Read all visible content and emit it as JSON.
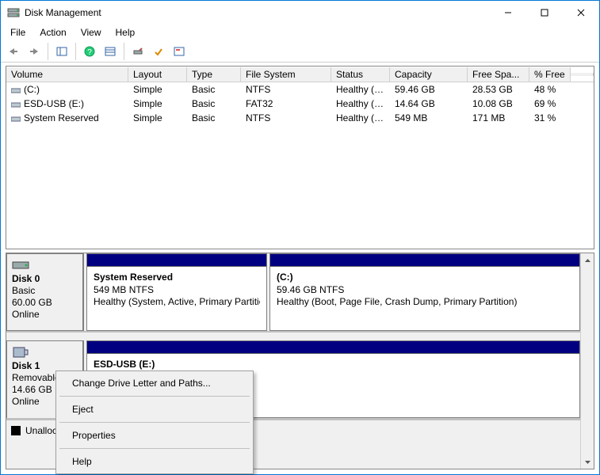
{
  "window": {
    "title": "Disk Management"
  },
  "menu": {
    "items": [
      "File",
      "Action",
      "View",
      "Help"
    ]
  },
  "volume_list": {
    "columns": [
      "Volume",
      "Layout",
      "Type",
      "File System",
      "Status",
      "Capacity",
      "Free Spa...",
      "% Free"
    ],
    "rows": [
      {
        "name": "(C:)",
        "layout": "Simple",
        "type": "Basic",
        "fs": "NTFS",
        "status": "Healthy (B...",
        "capacity": "59.46 GB",
        "free": "28.53 GB",
        "pct": "48 %"
      },
      {
        "name": "ESD-USB (E:)",
        "layout": "Simple",
        "type": "Basic",
        "fs": "FAT32",
        "status": "Healthy (A...",
        "capacity": "14.64 GB",
        "free": "10.08 GB",
        "pct": "69 %"
      },
      {
        "name": "System Reserved",
        "layout": "Simple",
        "type": "Basic",
        "fs": "NTFS",
        "status": "Healthy (S...",
        "capacity": "549 MB",
        "free": "171 MB",
        "pct": "31 %"
      }
    ]
  },
  "disks": {
    "disk0": {
      "label": "Disk 0",
      "kind": "Basic",
      "size": "60.00 GB",
      "state": "Online",
      "parts": [
        {
          "title": "System Reserved",
          "line2": "549 MB NTFS",
          "line3": "Healthy (System, Active, Primary Partition)"
        },
        {
          "title": "(C:)",
          "line2": "59.46 GB NTFS",
          "line3": "Healthy (Boot, Page File, Crash Dump, Primary Partition)"
        }
      ]
    },
    "disk1": {
      "label": "Disk 1",
      "kind": "Removable",
      "size": "14.66 GB",
      "state": "Online",
      "parts": [
        {
          "title": "ESD-USB (E:)",
          "line2": "",
          "line3": ""
        }
      ]
    }
  },
  "legend": {
    "unallocated": "Unalloc"
  },
  "context_menu": {
    "items": [
      "Change Drive Letter and Paths...",
      "Eject",
      "Properties",
      "Help"
    ]
  }
}
